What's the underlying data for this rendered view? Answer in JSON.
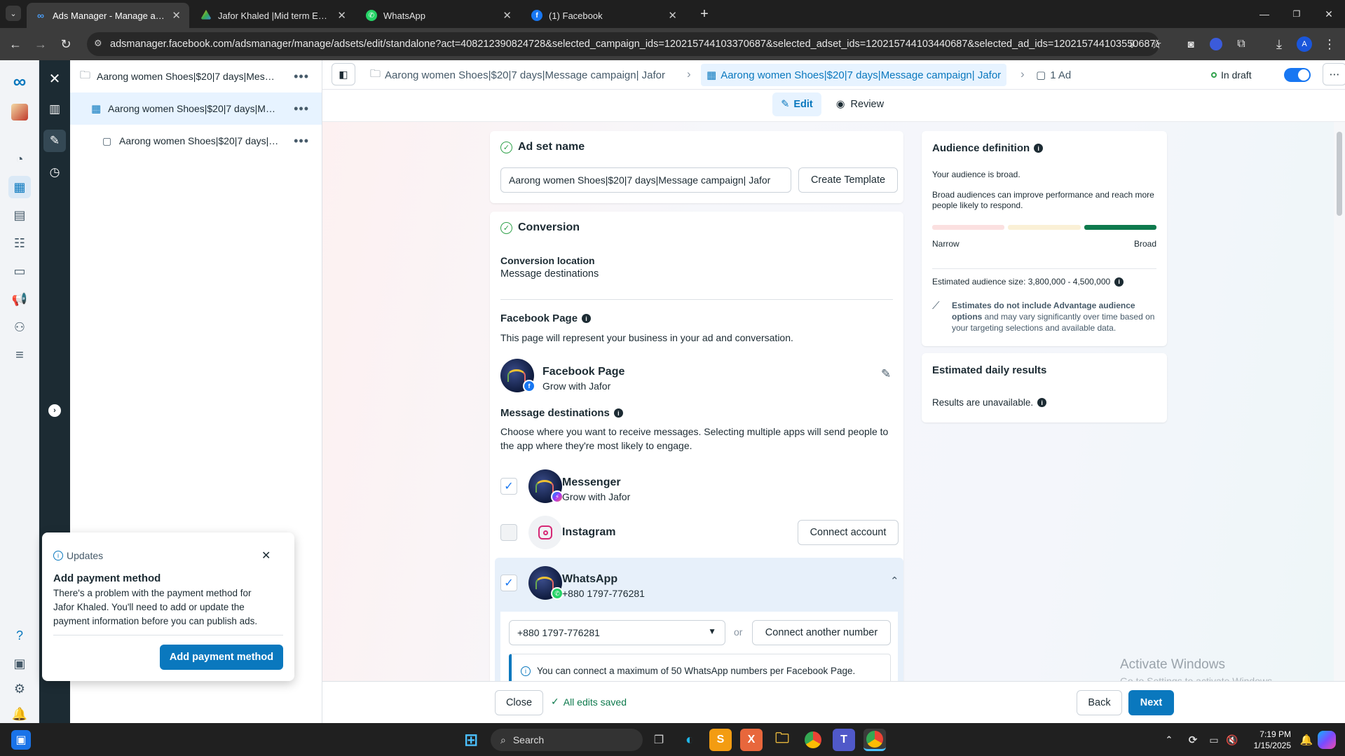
{
  "browser": {
    "tabs": [
      {
        "title": "Ads Manager - Manage ads - A",
        "icon": "meta-icon"
      },
      {
        "title": "Jafor Khaled |Mid term Exam| -",
        "icon": "google-drive-icon"
      },
      {
        "title": "WhatsApp",
        "icon": "whatsapp-icon"
      },
      {
        "title": "(1) Facebook",
        "icon": "facebook-icon"
      }
    ],
    "url": "adsmanager.facebook.com/adsmanager/manage/adsets/edit/standalone?act=408212390824728&selected_campaign_ids=120215744103370687&selected_adset_ids=120215744103440687&selected_ad_ids=120215744103550687&...",
    "profile_initial": "A"
  },
  "tree": {
    "campaign": "Aarong women Shoes|$20|7 days|Message campaign| Jafor",
    "adset": "Aarong women Shoes|$20|7 days|Message campaign| Jafor",
    "ad": "Aarong women Shoes|$20|7 days|Message campaign| Jafor"
  },
  "header": {
    "campaign_crumb": "Aarong women Shoes|$20|7 days|Message campaign| Jafor",
    "adset_crumb": "Aarong women Shoes|$20|7 days|Message campaign| Jafor",
    "ad_crumb": "1 Ad",
    "status": "In draft",
    "edit_label": "Edit",
    "review_label": "Review"
  },
  "adset_name": {
    "title": "Ad set name",
    "value": "Aarong women Shoes|$20|7 days|Message campaign| Jafor",
    "create_template": "Create Template"
  },
  "conversion": {
    "title": "Conversion",
    "location_label": "Conversion location",
    "location_value": "Message destinations",
    "fb_page_label": "Facebook Page",
    "fb_page_desc": "This page will represent your business in your ad and conversation.",
    "page_type": "Facebook Page",
    "page_name": "Grow with Jafor",
    "destinations_label": "Message destinations",
    "destinations_desc": "Choose where you want to receive messages. Selecting multiple apps will send people to the app where they're most likely to engage.",
    "messenger": {
      "name": "Messenger",
      "sub": "Grow with Jafor",
      "checked": true
    },
    "instagram": {
      "name": "Instagram",
      "button": "Connect account",
      "checked": false
    },
    "whatsapp": {
      "name": "WhatsApp",
      "sub": "+880 1797-776281",
      "checked": true
    },
    "whatsapp_number": "+880 1797-776281",
    "or": "or",
    "connect_another": "Connect another number",
    "info_note": "You can connect a maximum of 50 WhatsApp numbers per Facebook Page."
  },
  "audience": {
    "title": "Audience definition",
    "broad_text": "Your audience is broad.",
    "desc": "Broad audiences can improve performance and reach more people likely to respond.",
    "narrow": "Narrow",
    "broad": "Broad",
    "size_label": "Estimated audience size: 3,800,000 - 4,500,000",
    "note_bold": "Estimates do not include Advantage audience options",
    "note_rest": " and may vary significantly over time based on your targeting selections and available data."
  },
  "daily": {
    "title": "Estimated daily results",
    "text": "Results are unavailable."
  },
  "footer": {
    "close": "Close",
    "saved": "All edits saved",
    "back": "Back",
    "next": "Next"
  },
  "popup": {
    "header": "Updates",
    "title": "Add payment method",
    "body": "There's a problem with the payment method for Jafor Khaled. You'll need to add or update the payment information before you can publish ads.",
    "button": "Add payment method"
  },
  "watermark": {
    "line1": "Activate Windows",
    "line2": "Go to Settings to activate Windows."
  },
  "taskbar": {
    "search": "Search",
    "time": "7:19 PM",
    "date": "1/15/2025"
  },
  "colors": {
    "accent": "#0a78be",
    "success": "#31a24c",
    "meter_active": "#0e7a4d"
  }
}
